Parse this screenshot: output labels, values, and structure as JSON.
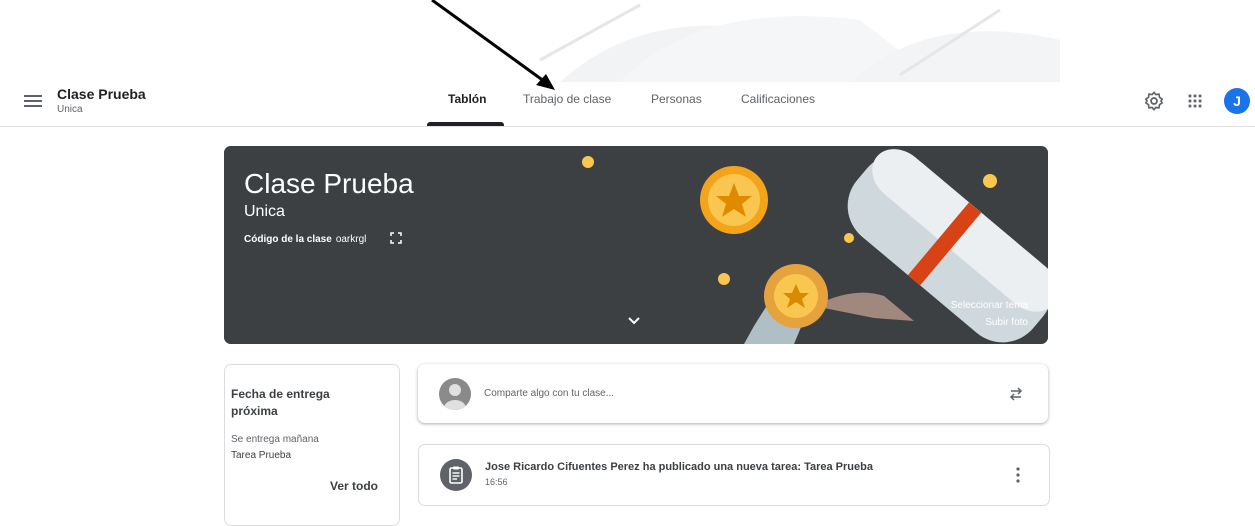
{
  "header": {
    "class_title": "Clase Prueba",
    "class_section": "Unica",
    "tabs": [
      {
        "label": "Tablón",
        "active": true
      },
      {
        "label": "Trabajo de clase",
        "active": false
      },
      {
        "label": "Personas",
        "active": false
      },
      {
        "label": "Calificaciones",
        "active": false
      }
    ],
    "icons": [
      "menu-icon",
      "settings-icon",
      "apps-icon"
    ],
    "avatar_letter": "J",
    "avatar_color": "#1a73e8"
  },
  "banner": {
    "title": "Clase Prueba",
    "subtitle": "Unica",
    "code_label": "Código de la clase",
    "code_value": "oarkrgl",
    "select_theme": "Seleccionar tema",
    "upload_photo": "Subir foto",
    "background_color": "#3c4043"
  },
  "upcoming": {
    "title": "Fecha de entrega próxima",
    "due_text": "Se entrega mañana",
    "task": "Tarea Prueba",
    "view_all": "Ver todo"
  },
  "share": {
    "placeholder": "Comparte algo con tu clase..."
  },
  "post": {
    "text": "Jose Ricardo Cifuentes Perez ha publicado una nueva tarea: Tarea Prueba",
    "time": "16:56"
  }
}
